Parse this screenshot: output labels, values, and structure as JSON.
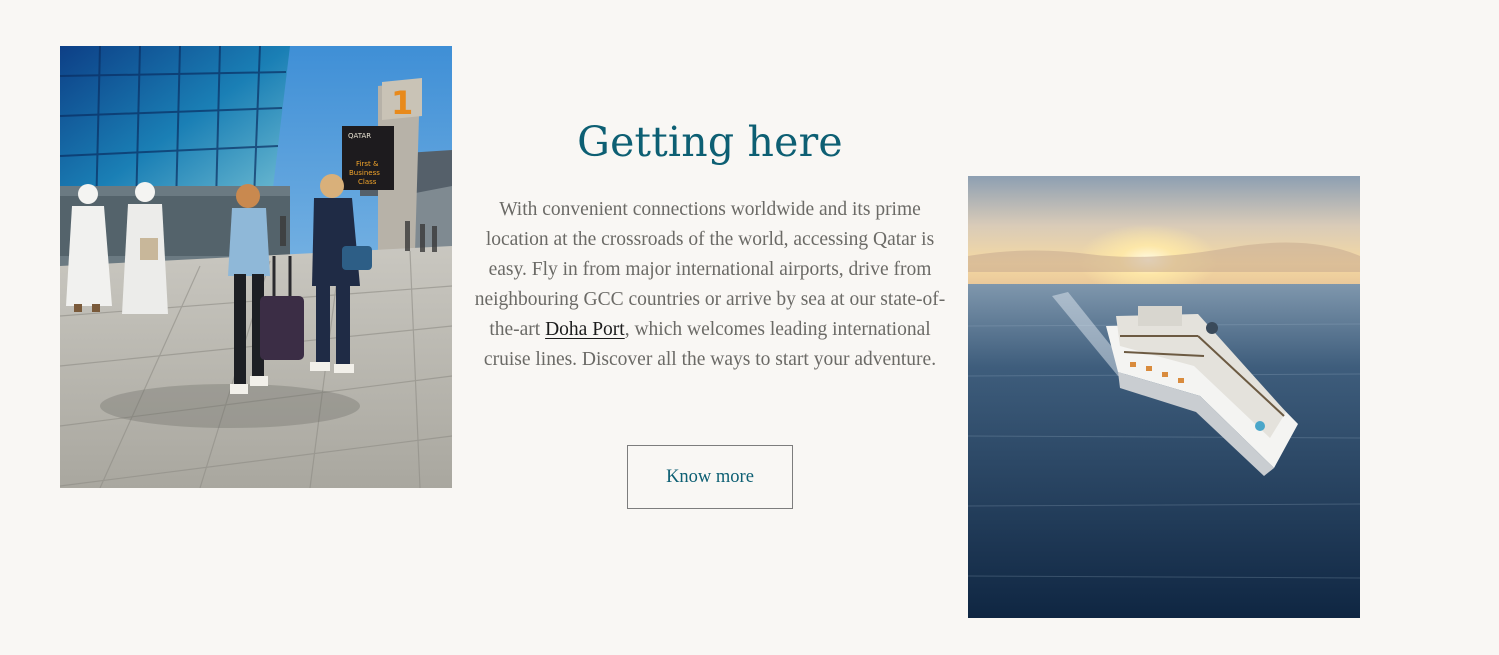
{
  "section": {
    "title": "Getting here",
    "body_before_link": "With convenient connections worldwide and its prime location at the crossroads of the world, accessing Qatar is easy. Fly in from major international airports, drive from neighbouring GCC countries or arrive by sea at our state-of-the-art ",
    "link_text": "Doha Port",
    "body_after_link": ", which welcomes leading international cruise lines. Discover all the ways to start your adventure.",
    "button_label": "Know more"
  },
  "images": {
    "left_sign_number": "1",
    "left_sign_brand": "QATAR",
    "left_sign_text_1": "First &",
    "left_sign_text_2": "Business",
    "left_sign_text_3": "Class"
  },
  "colors": {
    "background": "#f9f7f4",
    "title": "#0d5f73",
    "body": "#6b6a66",
    "link": "#1b1b1b",
    "button_border": "#7d7d7d"
  }
}
